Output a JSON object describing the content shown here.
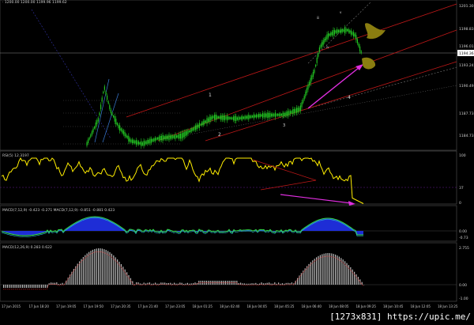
{
  "header": {
    "symbol_line": "· 1200.00 1200.00 1199.96 1199.62"
  },
  "main_chart": {
    "price_axis": [
      "1201.30",
      "1198.83",
      "1196.01",
      "1193.24",
      "1190.49",
      "1187.73",
      "1184.73"
    ],
    "current_price": "1194.36",
    "wave_labels": [
      "1",
      "2",
      "3",
      "4",
      "iii",
      "iv",
      "v"
    ]
  },
  "rsi_panel": {
    "label": "RSI(5) 12.3197",
    "axis": [
      "100",
      "37",
      "0"
    ]
  },
  "macd_panel": {
    "label": "MACD(7,12,9) -0.423 -0.271 MACD(7,12,9) -0.851 -0.881 0.423",
    "axis": [
      "0.00",
      "-0.73"
    ]
  },
  "macd2_panel": {
    "label": "MACD(12,26,9) 0.283 0.622",
    "axis": [
      "2.755",
      "0.00",
      "-1.00"
    ]
  },
  "time_axis": [
    "17 Jun 2015",
    "17 Jun 18:20",
    "17 Jun 19:05",
    "17 Jun 19:50",
    "17 Jun 20:35",
    "17 Jun 21:40",
    "17 Jun 23:05",
    "18 Jun 01:25",
    "18 Jun 02:40",
    "18 Jun 04:05",
    "18 Jun 05:25",
    "18 Jun 06:40",
    "18 Jun 08:05",
    "18 Jun 09:25",
    "18 Jun 10:45",
    "18 Jun 12:05",
    "18 Jun 13:25"
  ],
  "watermark": "[1273x831] https://upic.me/",
  "colors": {
    "bg": "#000000",
    "candle": "#22c322",
    "rsi": "#ffee00",
    "macd_fill": "#1e2dd6",
    "macd_line": "#33dd44",
    "arrow": "#e02ee0",
    "trend_red": "#c01818",
    "blob": "#8a7d10"
  }
}
